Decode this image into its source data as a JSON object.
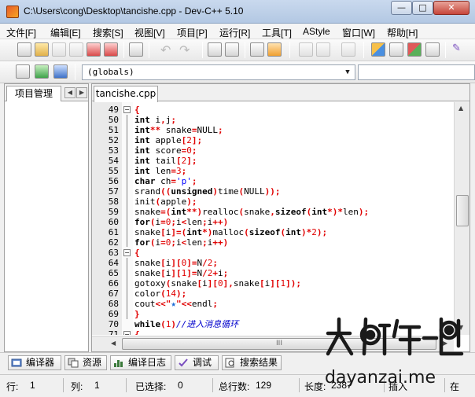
{
  "window": {
    "title": "C:\\Users\\cong\\Desktop\\tancishe.cpp - Dev-C++ 5.10",
    "minimize_icon": "minimize-icon",
    "maximize_icon": "maximize-icon",
    "close_icon": "close-icon"
  },
  "menu": {
    "items": [
      "文件[F]",
      "编辑[E]",
      "搜索[S]",
      "视图[V]",
      "项目[P]",
      "运行[R]",
      "工具[T]",
      "AStyle",
      "窗口[W]",
      "帮助[H]"
    ]
  },
  "toolbar2": {
    "globals_combo": "(globals)"
  },
  "left_panel": {
    "tab_label": "项目管理"
  },
  "editor": {
    "file_tab": "tancishe.cpp",
    "lines": [
      {
        "num": "49",
        "text": "{"
      },
      {
        "num": "50",
        "text": "int i,j;"
      },
      {
        "num": "51",
        "text": "int** snake=NULL;"
      },
      {
        "num": "52",
        "text": "int apple[2];"
      },
      {
        "num": "53",
        "text": "int score=0;"
      },
      {
        "num": "54",
        "text": "int tail[2];"
      },
      {
        "num": "55",
        "text": "int len=3;"
      },
      {
        "num": "56",
        "text": "char ch='p';"
      },
      {
        "num": "57",
        "text": "srand((unsigned)time(NULL));"
      },
      {
        "num": "58",
        "text": "init(apple);"
      },
      {
        "num": "59",
        "text": "snake=(int**)realloc(snake,sizeof(int*)*len);"
      },
      {
        "num": "60",
        "text": "for(i=0;i<len;i++)"
      },
      {
        "num": "61",
        "text": "snake[i]=(int*)malloc(sizeof(int)*2);"
      },
      {
        "num": "62",
        "text": "for(i=0;i<len;i++)"
      },
      {
        "num": "63",
        "text": "{"
      },
      {
        "num": "64",
        "text": "snake[i][0]=N/2;"
      },
      {
        "num": "65",
        "text": "snake[i][1]=N/2+i;"
      },
      {
        "num": "66",
        "text": "gotoxy(snake[i][0],snake[i][1]);"
      },
      {
        "num": "67",
        "text": "color(14);"
      },
      {
        "num": "68",
        "text": "cout<<\"★\"<<endl;"
      },
      {
        "num": "69",
        "text": "}"
      },
      {
        "num": "70",
        "text": "while(1)//进入消息循环"
      },
      {
        "num": "71",
        "text": "{"
      }
    ],
    "hscroll_grip": "III"
  },
  "bottom_tabs": [
    "编译器",
    "资源",
    "编译日志",
    "调试",
    "搜索结果"
  ],
  "status": {
    "row_label": "行:",
    "row_value": "1",
    "col_label": "列:",
    "col_value": "1",
    "sel_label": "已选择:",
    "sel_value": "0",
    "total_label": "总行数:",
    "total_value": "129",
    "len_label": "长度:",
    "len_value": "2387",
    "mode": "插入",
    "extra": "在"
  },
  "watermark": {
    "text": "大眼仔~旭",
    "url": "dayanzai.me"
  }
}
